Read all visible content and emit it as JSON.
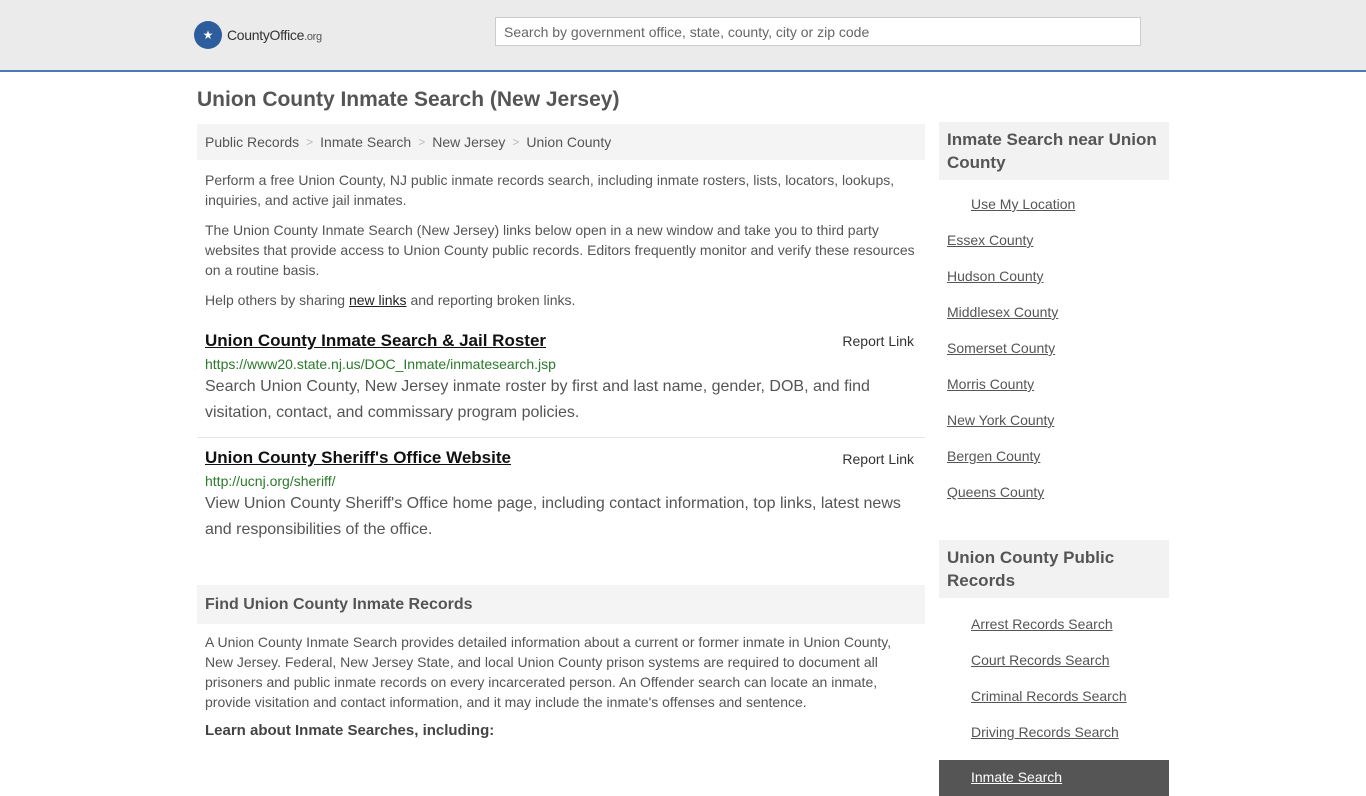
{
  "header": {
    "logo_text": "CountyOffice",
    "logo_suffix": ".org",
    "search_placeholder": "Search by government office, state, county, city or zip code"
  },
  "page_title": "Union County Inmate Search (New Jersey)",
  "breadcrumb": [
    "Public Records",
    "Inmate Search",
    "New Jersey",
    "Union County"
  ],
  "intro": {
    "p1": "Perform a free Union County, NJ public inmate records search, including inmate rosters, lists, locators, lookups, inquiries, and active jail inmates.",
    "p2": "The Union County Inmate Search (New Jersey) links below open in a new window and take you to third party websites that provide access to Union County public records. Editors frequently monitor and verify these resources on a routine basis.",
    "p3_before": "Help others by sharing ",
    "p3_link": "new links",
    "p3_after": " and reporting broken links."
  },
  "links": [
    {
      "title": "Union County Inmate Search & Jail Roster",
      "report": "Report Link",
      "url": "https://www20.state.nj.us/DOC_Inmate/inmatesearch.jsp",
      "desc": "Search Union County, New Jersey inmate roster by first and last name, gender, DOB, and find visitation, contact, and commissary program policies."
    },
    {
      "title": "Union County Sheriff's Office Website",
      "report": "Report Link",
      "url": "http://ucnj.org/sheriff/",
      "desc": "View Union County Sheriff's Office home page, including contact information, top links, latest news and responsibilities of the office."
    }
  ],
  "find_section": {
    "heading": "Find Union County Inmate Records",
    "body": "A Union County Inmate Search provides detailed information about a current or former inmate in Union County, New Jersey. Federal, New Jersey State, and local Union County prison systems are required to document all prisoners and public inmate records on every incarcerated person. An Offender search can locate an inmate, provide visitation and contact information, and it may include the inmate's offenses and sentence.",
    "learn": "Learn about Inmate Searches, including:"
  },
  "sidebar": {
    "nearby_heading": "Inmate Search near Union County",
    "use_location": "Use My Location",
    "nearby": [
      "Essex County",
      "Hudson County",
      "Middlesex County",
      "Somerset County",
      "Morris County",
      "New York County",
      "Bergen County",
      "Queens County"
    ],
    "records_heading": "Union County Public Records",
    "records": [
      "Arrest Records Search",
      "Court Records Search",
      "Criminal Records Search",
      "Driving Records Search"
    ],
    "active": "Inmate Search"
  },
  "colors": {
    "accent_border": "#4a79b5",
    "url_green": "#2b7a2b",
    "logo_blue": "#2e5d9e",
    "active_bg": "#555555"
  }
}
